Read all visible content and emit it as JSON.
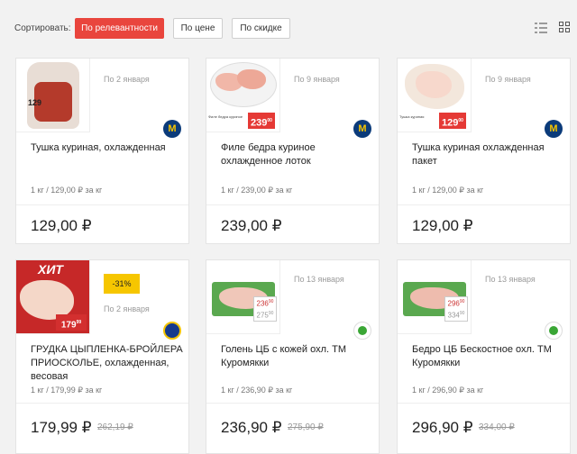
{
  "toolbar": {
    "sort_label": "Сортировать:",
    "sort_options": [
      "По релевантности",
      "По цене",
      "По скидке"
    ],
    "active_color": "#e9453d"
  },
  "products": [
    {
      "date": "По 2 января",
      "title": "Тушка куриная, охлажденная",
      "unit_price": "1 кг / 129,00 ₽ за кг",
      "price": "129,00 ₽",
      "image_price": "129",
      "store_icon": "metro-icon"
    },
    {
      "date": "По 9 января",
      "title": "Филе бедра куриное охлажденное лоток",
      "unit_price": "1 кг / 239,00 ₽ за кг",
      "price": "239,00 ₽",
      "image_price": "239",
      "image_cents": "00",
      "image_caption": "Филе бедра куриное",
      "store_icon": "metro-icon"
    },
    {
      "date": "По 9 января",
      "title": "Тушка куриная охлажденная пакет",
      "unit_price": "1 кг / 129,00 ₽ за кг",
      "price": "129,00 ₽",
      "image_price": "129",
      "image_cents": "00",
      "image_caption": "Тушка куриная",
      "store_icon": "metro-icon"
    },
    {
      "discount": "-31%",
      "date": "По 2 января",
      "title": "ГРУДКА ЦЫПЛЕНКА-БРОЙЛЕРА ПРИОСКОЛЬЕ, охлажденная, весовая",
      "unit_price": "1 кг / 179,99 ₽ за кг",
      "price": "179,99 ₽",
      "old_price": "262,19 ₽",
      "image_banner": "ХИТ",
      "image_price": "179",
      "image_cents": "99",
      "store_icon": "lenta-icon"
    },
    {
      "date": "По 13 января",
      "title": "Голень ЦБ с кожей охл. ТМ Куромякки",
      "unit_price": "1 кг / 236,90 ₽ за кг",
      "price": "236,90 ₽",
      "old_price": "275,90 ₽",
      "image_price": "236",
      "image_cents": "90",
      "image_old_price": "275",
      "image_old_cents": "90",
      "store_icon": "perekrestok-icon"
    },
    {
      "date": "По 13 января",
      "title": "Бедро ЦБ Бескостное охл. ТМ Куромякки",
      "unit_price": "1 кг / 296,90 ₽ за кг",
      "price": "296,90 ₽",
      "old_price": "334,00 ₽",
      "image_price": "296",
      "image_cents": "90",
      "image_old_price": "334",
      "image_old_cents": "90",
      "store_icon": "perekrestok-icon"
    }
  ]
}
